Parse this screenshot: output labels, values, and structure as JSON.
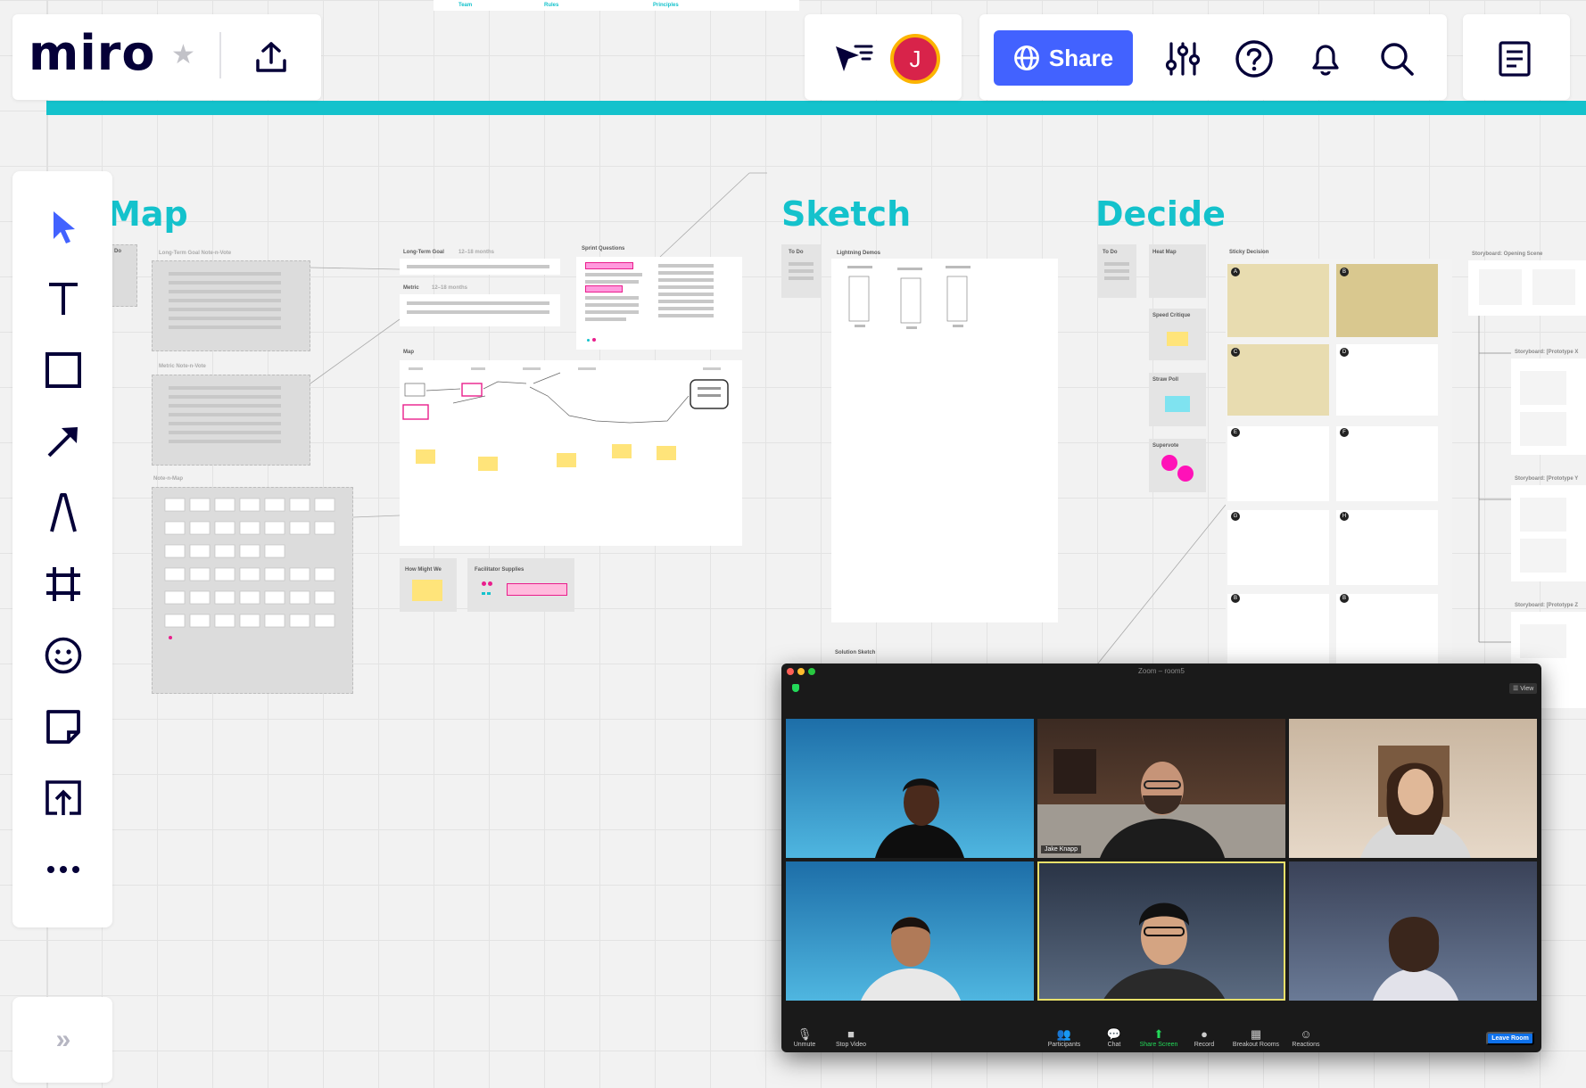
{
  "toolbar": {
    "logo": "miro",
    "share_label": "Share",
    "avatar_initial": "J"
  },
  "top_strip": {
    "labels": [
      "Team",
      "Rules",
      "Principles"
    ]
  },
  "sections": {
    "map": "Map",
    "sketch": "Sketch",
    "decide": "Decide"
  },
  "frames": {
    "map_todo": "Do",
    "long_term_vote": "Long-Term Goal Note-n-Vote",
    "metric_vote": "Metric Note-n-Vote",
    "note_n_map": "Note-n-Map",
    "long_term_goal": "Long-Term Goal",
    "long_term_period": "12–18 months",
    "metric": "Metric",
    "metric_period": "12–18 months",
    "sprint_questions": "Sprint Questions",
    "map": "Map",
    "how_might_we": "How Might We",
    "facilitator_supplies": "Facilitator Supplies",
    "sketch_todo": "To Do",
    "lightning_demos": "Lightning Demos",
    "solution_sketch": "Solution Sketch",
    "decide_todo": "To Do",
    "heat_map": "Heat Map",
    "speed_critique": "Speed Critique",
    "straw_poll": "Straw Poll",
    "supervote": "Supervote",
    "sticky_decision": "Sticky Decision",
    "storyboard_opening": "Storyboard: Opening Scene",
    "storyboard_x": "Storyboard: [Prototype X",
    "storyboard_y": "Storyboard: [Prototype Y",
    "storyboard_z": "Storyboard: [Prototype Z"
  },
  "decision_slots": [
    "A",
    "B",
    "C",
    "D",
    "E",
    "F",
    "G",
    "H",
    "B",
    "B"
  ],
  "zoom": {
    "title": "Zoom – room5",
    "view": "View",
    "participant_name": "Jake Knapp",
    "controls": [
      "Unmute",
      "Stop Video",
      "Participants",
      "Chat",
      "Share Screen",
      "Record",
      "Breakout Rooms",
      "Reactions"
    ],
    "leave": "Leave Room"
  }
}
